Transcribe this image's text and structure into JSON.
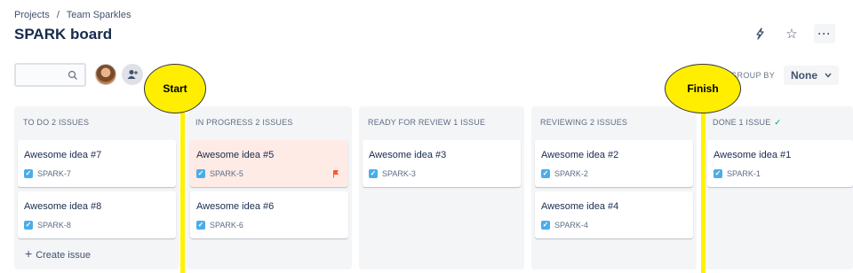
{
  "breadcrumb": {
    "projects": "Projects",
    "separator": "/",
    "project": "Team Sparkles"
  },
  "page_title": "SPARK board",
  "header_icons": {
    "flag": "lightning-icon",
    "star": "☆",
    "more": "···"
  },
  "toolbar": {
    "group_by_label": "GROUP BY",
    "group_by_value": "None",
    "group_by_chevron": "⌄"
  },
  "annotations": {
    "start": "Start",
    "finish": "Finish"
  },
  "columns": [
    {
      "title": "TO DO 2 ISSUES",
      "cards": [
        {
          "title": "Awesome idea #7",
          "key": "SPARK-7"
        },
        {
          "title": "Awesome idea #8",
          "key": "SPARK-8"
        }
      ],
      "create_label": "Create issue"
    },
    {
      "title": "IN PROGRESS 2 ISSUES",
      "cards": [
        {
          "title": "Awesome idea #5",
          "key": "SPARK-5",
          "flagged": true
        },
        {
          "title": "Awesome idea #6",
          "key": "SPARK-6"
        }
      ]
    },
    {
      "title": "READY FOR REVIEW 1 ISSUE",
      "cards": [
        {
          "title": "Awesome idea #3",
          "key": "SPARK-3"
        }
      ]
    },
    {
      "title": "REVIEWING 2 ISSUES",
      "cards": [
        {
          "title": "Awesome idea #2",
          "key": "SPARK-2"
        },
        {
          "title": "Awesome idea #4",
          "key": "SPARK-4"
        }
      ]
    },
    {
      "title": "DONE 1 ISSUE",
      "done_check": "✓",
      "cards": [
        {
          "title": "Awesome idea #1",
          "key": "SPARK-1"
        }
      ]
    }
  ],
  "colors": {
    "accent": "#4BADE8",
    "highlight": "#FFF200",
    "flag": "#FF5630",
    "column_bg": "#F4F5F7"
  }
}
